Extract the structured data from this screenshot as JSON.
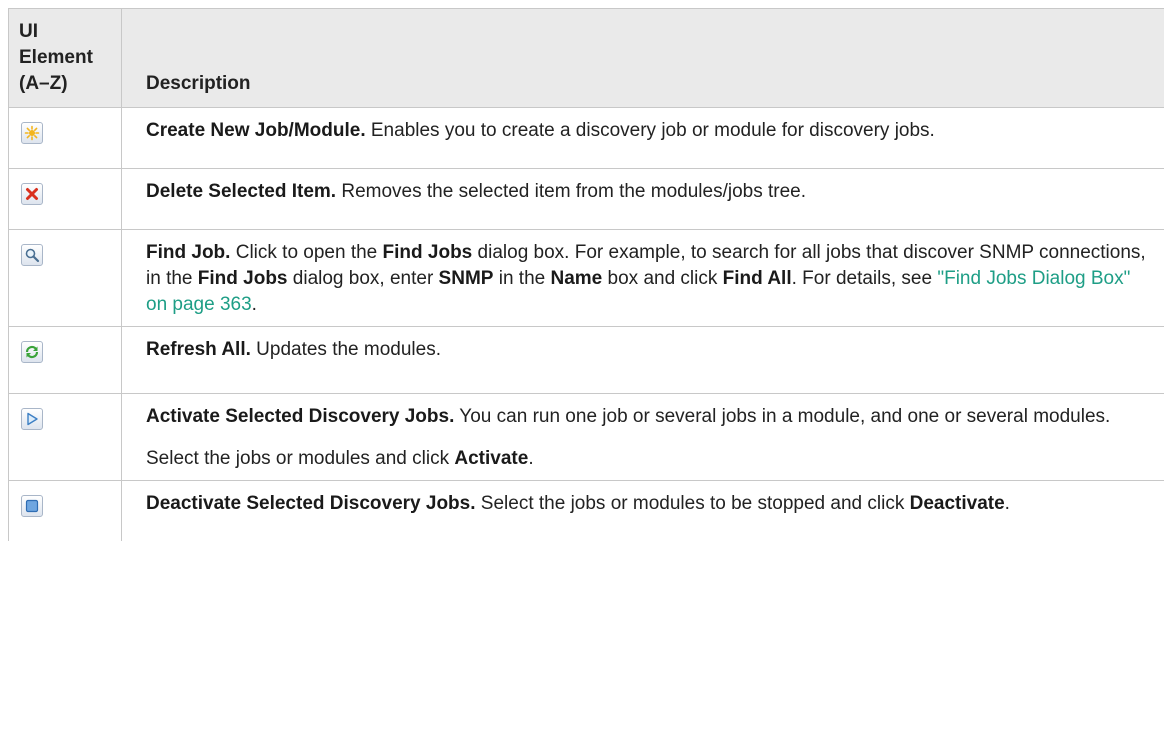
{
  "table": {
    "header": {
      "col1_line1": "UI",
      "col1_line2": "Element",
      "col1_line3": "(A–Z)",
      "col2": "Description"
    },
    "rows": [
      {
        "icon": "create-new-job-icon",
        "title": "Create New Job/Module.",
        "text": " Enables you to create a discovery job or module for discovery jobs."
      },
      {
        "icon": "delete-item-icon",
        "title": "Delete Selected Item.",
        "text": " Removes the selected item from the modules/jobs tree."
      },
      {
        "icon": "find-job-icon",
        "title": "Find Job.",
        "t1": " Click to open the ",
        "b1": "Find Jobs",
        "t2": " dialog box. For example, to search for all jobs that discover SNMP connections, in the ",
        "b2": "Find Jobs",
        "t3": " dialog box, enter ",
        "b3": "SNMP",
        "t4": " in the ",
        "b4": "Name",
        "t5": " box and click ",
        "b5": "Find All",
        "t6": ". For details, see ",
        "link": "\"Find Jobs Dialog Box\" on page 363",
        "t7": "."
      },
      {
        "icon": "refresh-icon",
        "title": "Refresh All.",
        "text": " Updates the modules."
      },
      {
        "icon": "activate-icon",
        "title": "Activate Selected Discovery Jobs.",
        "text": " You can run one job or several jobs in a module, and one or several modules.",
        "p2_text": "Select the jobs or modules and click ",
        "p2_bold": "Activate",
        "p2_end": "."
      },
      {
        "icon": "deactivate-icon",
        "title": "Deactivate Selected Discovery Jobs.",
        "text": " Select the jobs or modules to be stopped and click ",
        "bold_end": "Deactivate",
        "end": "."
      }
    ]
  },
  "colors": {
    "header_bg": "#eaeaea",
    "border": "#c8c8c8",
    "link": "#1e9e86"
  }
}
